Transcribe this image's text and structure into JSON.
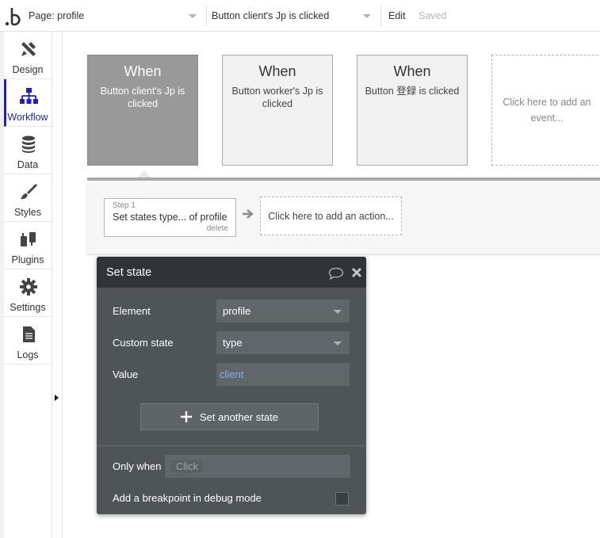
{
  "topbar": {
    "page_label": "Page: profile",
    "event_label": "Button client's Jp is clicked",
    "edit_label": "Edit",
    "saved_label": "Saved"
  },
  "sidebar": {
    "items": [
      {
        "label": "Design",
        "icon": "design-icon"
      },
      {
        "label": "Workflow",
        "icon": "workflow-icon",
        "active": true
      },
      {
        "label": "Data",
        "icon": "database-icon"
      },
      {
        "label": "Styles",
        "icon": "brush-icon"
      },
      {
        "label": "Plugins",
        "icon": "plug-icon"
      },
      {
        "label": "Settings",
        "icon": "gear-icon"
      },
      {
        "label": "Logs",
        "icon": "document-icon"
      }
    ]
  },
  "events": [
    {
      "when": "When",
      "desc": "Button client's Jp is clicked",
      "selected": true
    },
    {
      "when": "When",
      "desc": "Button worker's Jp is clicked",
      "selected": false
    },
    {
      "when": "When",
      "desc": "Button 登録 is clicked",
      "selected": false
    }
  ],
  "add_event_label": "Click here to add an event...",
  "step": {
    "number": "Step 1",
    "title": "Set states type... of profile",
    "delete_label": "delete"
  },
  "add_action_label": "Click here to add an action...",
  "editor": {
    "title": "Set state",
    "element_label": "Element",
    "element_value": "profile",
    "custom_state_label": "Custom state",
    "custom_state_value": "type",
    "value_label": "Value",
    "value_value": "client",
    "set_another_label": "Set another state",
    "only_when_label": "Only when",
    "only_when_placeholder": "Click",
    "breakpoint_label": "Add a breakpoint in debug mode",
    "value_color": "#7fb2f0"
  },
  "colors": {
    "accent": "#1f1fc8",
    "editor_bg": "#4f5456",
    "editor_header": "#303436",
    "selected_event": "#999999"
  }
}
